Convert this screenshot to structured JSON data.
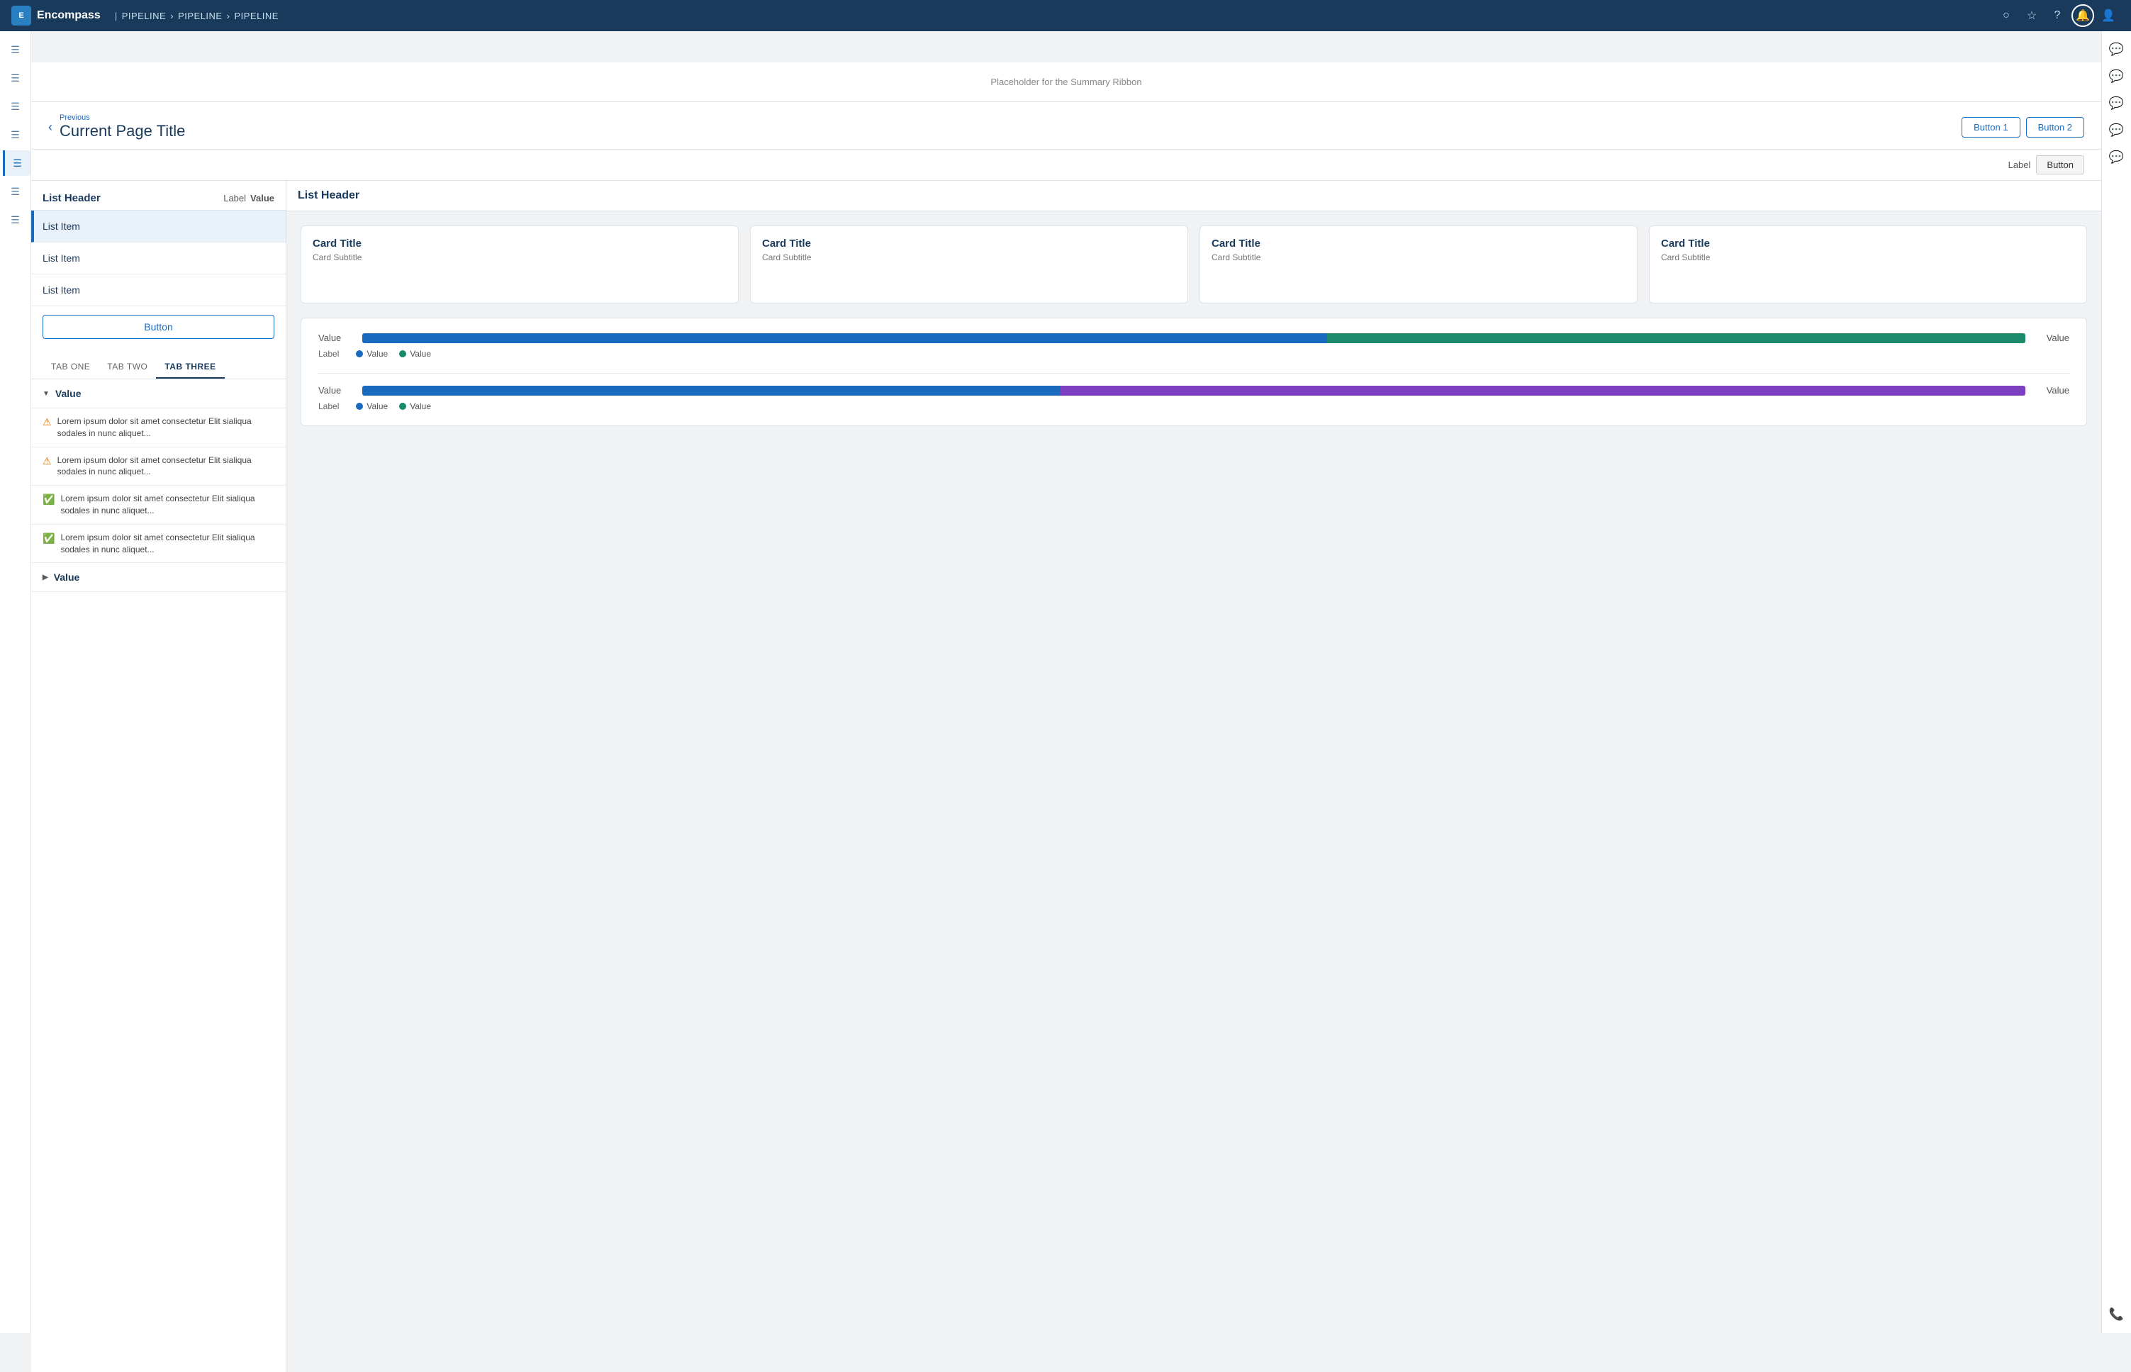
{
  "app": {
    "name": "Encompass",
    "logo_text": "E"
  },
  "breadcrumb": {
    "items": [
      "PIPELINE",
      "PIPELINE",
      "PIPELINE"
    ]
  },
  "summary_ribbon": {
    "text": "Placeholder for the Summary Ribbon"
  },
  "page_header": {
    "previous_label": "Previous",
    "title": "Current Page Title",
    "button1_label": "Button 1",
    "button2_label": "Button 2"
  },
  "secondary_toolbar": {
    "label": "Label",
    "button_label": "Button"
  },
  "left_panel": {
    "header_title": "List Header",
    "header_label": "Label",
    "header_value": "Value",
    "list_items": [
      {
        "label": "List Item",
        "active": true
      },
      {
        "label": "List Item",
        "active": false
      },
      {
        "label": "List Item",
        "active": false
      }
    ],
    "button_label": "Button",
    "tabs": [
      {
        "label": "TAB ONE",
        "active": false
      },
      {
        "label": "TAB TWO",
        "active": false
      },
      {
        "label": "TAB THREE",
        "active": true
      }
    ],
    "accordion_groups": [
      {
        "label": "Value",
        "expanded": true,
        "items": [
          {
            "type": "warn",
            "text": "Lorem ipsum dolor sit amet consectetur\nElit sialiqua sodales in nunc aliquet..."
          },
          {
            "type": "warn",
            "text": "Lorem ipsum dolor sit amet consectetur\nElit sialiqua sodales in nunc aliquet..."
          },
          {
            "type": "success",
            "text": "Lorem ipsum dolor sit amet consectetur\nElit sialiqua sodales in nunc aliquet..."
          },
          {
            "type": "success",
            "text": "Lorem ipsum dolor sit amet consectetur\nElit sialiqua sodales in nunc aliquet..."
          }
        ]
      },
      {
        "label": "Value",
        "expanded": false,
        "items": []
      }
    ]
  },
  "right_panel": {
    "header_title": "List Header",
    "cards": [
      {
        "title": "Card Title",
        "subtitle": "Card Subtitle"
      },
      {
        "title": "Card Title",
        "subtitle": "Card Subtitle"
      },
      {
        "title": "Card Title",
        "subtitle": "Card Subtitle"
      },
      {
        "title": "Card Title",
        "subtitle": "Card Subtitle"
      }
    ],
    "charts": [
      {
        "value_left": "Value",
        "value_right": "Value",
        "bar1_pct": 58,
        "bar2_pct": 42,
        "bar1_color": "blue",
        "bar2_color": "teal",
        "legend_label": "Label",
        "legend_items": [
          {
            "label": "Value",
            "color": "blue"
          },
          {
            "label": "Value",
            "color": "teal"
          }
        ]
      },
      {
        "value_left": "Value",
        "value_right": "Value",
        "bar1_pct": 42,
        "bar2_pct": 58,
        "bar1_color": "blue",
        "bar2_color": "purple",
        "legend_label": "Label",
        "legend_items": [
          {
            "label": "Value",
            "color": "blue"
          },
          {
            "label": "Value",
            "color": "teal"
          }
        ]
      }
    ]
  },
  "nav_icons": {
    "search": "○",
    "star": "☆",
    "help": "?",
    "notifications": "🔔",
    "user": "👤"
  },
  "left_sidebar_icons": [
    "≡",
    "≡",
    "≡",
    "≡",
    "≡",
    "≡",
    "≡"
  ],
  "right_sidebar_icons": [
    "💬",
    "💬",
    "💬",
    "💬",
    "💬",
    "📞"
  ]
}
